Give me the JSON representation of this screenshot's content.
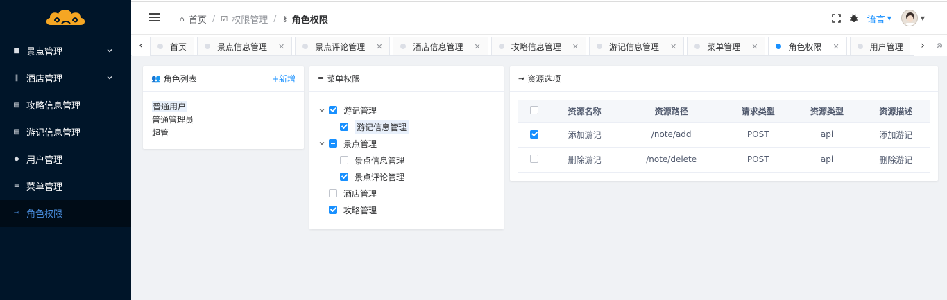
{
  "sidebar": {
    "items": [
      {
        "label": "景点管理",
        "icon": "book-icon",
        "has_children": true
      },
      {
        "label": "酒店管理",
        "icon": "fork-knife-icon",
        "has_children": true
      },
      {
        "label": "攻略信息管理",
        "icon": "document-icon",
        "has_children": false
      },
      {
        "label": "游记信息管理",
        "icon": "document-icon",
        "has_children": false
      },
      {
        "label": "用户管理",
        "icon": "users-icon",
        "has_children": false
      },
      {
        "label": "菜单管理",
        "icon": "menu-icon",
        "has_children": false
      },
      {
        "label": "角色权限",
        "icon": "key-icon",
        "has_children": false,
        "active": true
      }
    ]
  },
  "header": {
    "breadcrumb": [
      {
        "label": "首页",
        "icon": "home-icon"
      },
      {
        "label": "权限管理",
        "icon": "checkbox-icon"
      },
      {
        "label": "角色权限",
        "icon": "key-icon"
      }
    ],
    "language_label": "语言"
  },
  "tabs": [
    {
      "label": "首页",
      "closable": false,
      "active": false
    },
    {
      "label": "景点信息管理",
      "closable": true,
      "active": false
    },
    {
      "label": "景点评论管理",
      "closable": true,
      "active": false
    },
    {
      "label": "酒店信息管理",
      "closable": true,
      "active": false
    },
    {
      "label": "攻略信息管理",
      "closable": true,
      "active": false
    },
    {
      "label": "游记信息管理",
      "closable": true,
      "active": false
    },
    {
      "label": "菜单管理",
      "closable": true,
      "active": false
    },
    {
      "label": "角色权限",
      "closable": true,
      "active": true
    },
    {
      "label": "用户管理",
      "closable": true,
      "active": false
    }
  ],
  "role_card": {
    "title": "角色列表",
    "add_label": "+新增",
    "roles": [
      "普通用户",
      "普通管理员",
      "超管"
    ]
  },
  "menu_card": {
    "title": "菜单权限",
    "tree": [
      {
        "label": "游记管理",
        "state": "checked",
        "level": 0,
        "expanded": true
      },
      {
        "label": "游记信息管理",
        "state": "checked",
        "level": 1,
        "highlight": true
      },
      {
        "label": "景点管理",
        "state": "indeterminate",
        "level": 0,
        "expanded": true
      },
      {
        "label": "景点信息管理",
        "state": "unchecked",
        "level": 1
      },
      {
        "label": "景点评论管理",
        "state": "checked",
        "level": 1
      },
      {
        "label": "酒店管理",
        "state": "unchecked",
        "level": 0
      },
      {
        "label": "攻略管理",
        "state": "checked",
        "level": 0
      }
    ]
  },
  "resource_card": {
    "title": "资源选项",
    "columns": [
      "资源名称",
      "资源路径",
      "请求类型",
      "资源类型",
      "资源描述"
    ],
    "rows": [
      {
        "checked": true,
        "cells": [
          "添加游记",
          "/note/add",
          "POST",
          "api",
          "添加游记"
        ]
      },
      {
        "checked": false,
        "cells": [
          "删除游记",
          "/note/delete",
          "POST",
          "api",
          "删除游记"
        ]
      }
    ]
  },
  "colors": {
    "sidebar_bg": "#001529",
    "accent": "#1890ff",
    "logo": "#f5a623"
  }
}
